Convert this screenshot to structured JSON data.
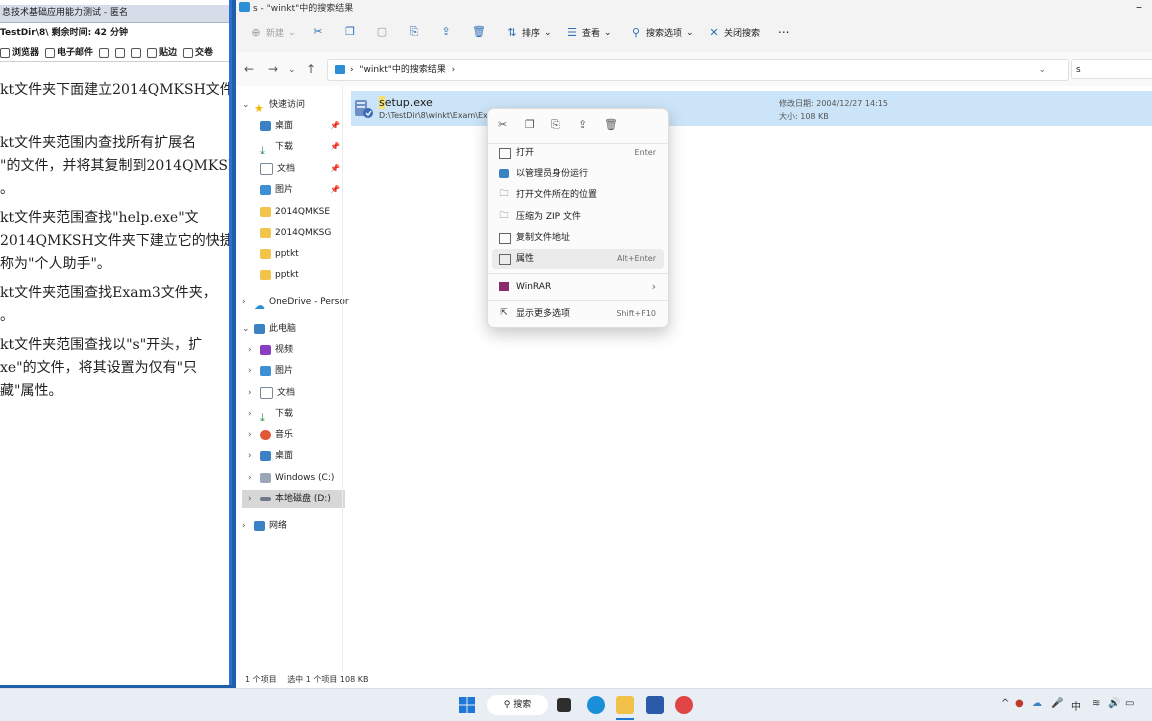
{
  "exam": {
    "title": "息技术基础应用能力测试 - 匿名",
    "status": "TestDir\\8\\  剩余时间: 42 分钟",
    "toolbar": [
      "浏览器",
      "电子邮件",
      "",
      "",
      "",
      "贴边",
      "交卷"
    ],
    "questions": [
      "kt文件夹下面建立2014QMKSH文件",
      "",
      "kt文件夹范围内查找所有扩展名",
      "\"的文件，并将其复制到2014QMKSH",
      "。",
      "kt文件夹范围查找\"help.exe\"文",
      "2014QMKSH文件夹下建立它的快捷",
      "称为\"个人助手\"。",
      "kt文件夹范围查找Exam3文件夹，",
      "。",
      "kt文件夹范围查找以\"s\"开头，扩",
      "xe\"的文件，将其设置为仅有\"只",
      "藏\"属性。"
    ]
  },
  "explorer": {
    "title": "s - \"winkt\"中的搜索结果",
    "toolbar": {
      "new": "新建",
      "sort": "排序",
      "view": "查看",
      "search_options": "搜索选项",
      "close_search": "关闭搜索",
      "more": "..."
    },
    "address": "\"winkt\"中的搜索结果",
    "search_value": "s",
    "nav": {
      "quick_access": "快速访问",
      "desktop": "桌面",
      "downloads": "下载",
      "documents": "文档",
      "pictures": "图片",
      "f1": "2014QMKSE",
      "f2": "2014QMKSG",
      "f3": "pptkt",
      "f4": "pptkt",
      "onedrive": "OneDrive - Persor",
      "this_pc": "此电脑",
      "videos": "视频",
      "pictures2": "图片",
      "documents2": "文档",
      "downloads2": "下载",
      "music": "音乐",
      "desktop2": "桌面",
      "drive_c": "Windows (C:)",
      "drive_d": "本地磁盘 (D:)",
      "network": "网络"
    },
    "file": {
      "name_hl": "s",
      "name_rest": "etup.exe",
      "path": "D:\\TestDir\\8\\winkt\\Exam\\Ex",
      "modified": "修改日期: 2004/12/27 14:15",
      "size": "大小: 108 KB"
    },
    "status": {
      "count": "1 个项目",
      "selected": "选中 1 个项目  108 KB"
    }
  },
  "context_menu": {
    "items": [
      {
        "label": "打开",
        "shortcut": "Enter"
      },
      {
        "label": "以管理员身份运行",
        "shortcut": ""
      },
      {
        "label": "打开文件所在的位置",
        "shortcut": ""
      },
      {
        "label": "压缩为 ZIP 文件",
        "shortcut": ""
      },
      {
        "label": "复制文件地址",
        "shortcut": ""
      },
      {
        "label": "属性",
        "shortcut": "Alt+Enter"
      },
      {
        "label": "WinRAR",
        "shortcut": "›"
      },
      {
        "label": "显示更多选项",
        "shortcut": "Shift+F10"
      }
    ]
  },
  "taskbar": {
    "search": "搜索",
    "ime": "中"
  },
  "colors": {
    "selection": "#cce4f7",
    "accent": "#2c8fd6",
    "taskbar": "#e9eef4"
  }
}
